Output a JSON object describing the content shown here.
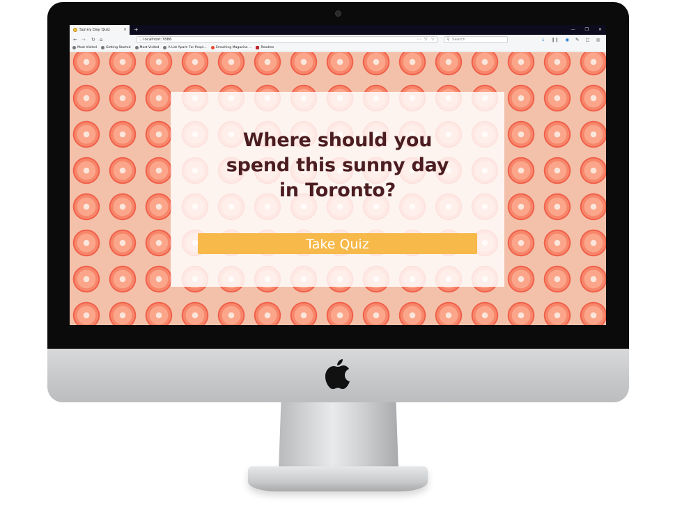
{
  "browser": {
    "tab_title": "Sunny Day Quiz",
    "tab_close": "×",
    "new_tab": "+",
    "window_controls": [
      "—",
      "❐",
      "✕"
    ],
    "url": "localhost:7886",
    "search_placeholder": "Search",
    "bookmarks": [
      "Most Visited",
      "Getting Started",
      "Most Visited",
      "A List Apart: For Peopl...",
      "Smashing Magazine ...",
      "Readme"
    ]
  },
  "icons": {
    "back": "back-arrow-icon",
    "forward": "forward-arrow-icon",
    "reload": "reload-icon",
    "home": "home-icon",
    "apple": "apple-logo-icon"
  },
  "page": {
    "headline_lines": [
      "Where should you",
      "spend this sunny day",
      "in Toronto?"
    ],
    "button_label": "Take Quiz"
  },
  "colors": {
    "page_background": "#f3c1aa",
    "orange_slice": "#f7866b",
    "button": "#f6b94a",
    "headline": "#4b1d20"
  }
}
